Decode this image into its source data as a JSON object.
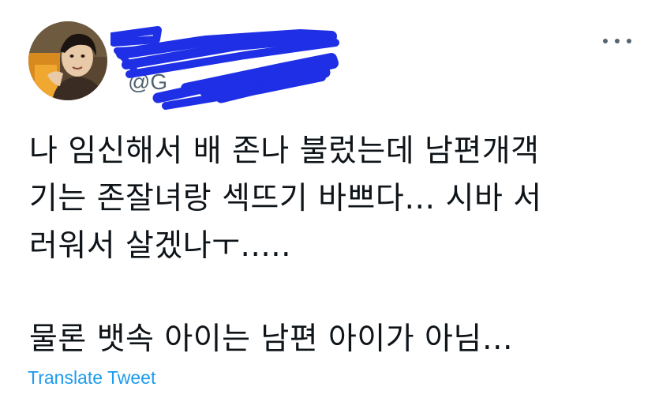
{
  "tweet": {
    "author_handle": "@G",
    "author_avatar_icon": "profile-photo",
    "more_icon": "more-horizontal-icon",
    "text_lines": [
      "나 임신해서 배 존나 불렀는데 남편개객",
      "기는 존잘녀랑 섹뜨기 바쁘다… 시바 서",
      "러워서 살겠나ㅜ.....",
      "물론 뱃속 아이는 남편 아이가 아님…"
    ],
    "translate_label": "Translate Tweet"
  },
  "colors": {
    "text": "#0f1419",
    "secondary": "#536471",
    "link": "#1d9bf0",
    "redaction": "#1f2fe6"
  }
}
